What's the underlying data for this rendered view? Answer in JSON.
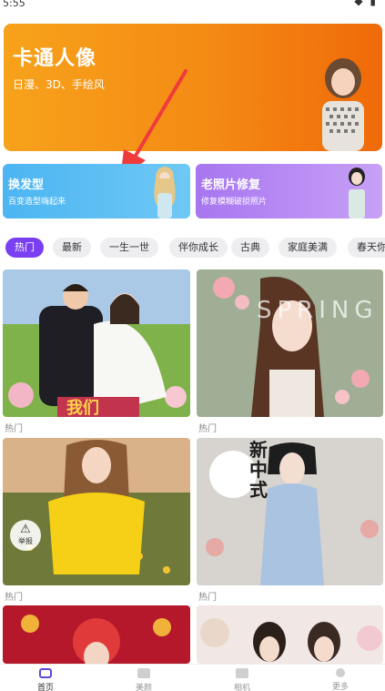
{
  "status": {
    "time": "5:55",
    "icons": "◆ ▮"
  },
  "hero": {
    "title": "卡通人像",
    "subtitle": "日漫、3D、手绘风"
  },
  "cards": [
    {
      "title": "换发型",
      "subtitle": "百变造型嗨起来"
    },
    {
      "title": "老照片修复",
      "subtitle": "修复模糊破损照片"
    }
  ],
  "tabs": [
    "热门",
    "最新",
    "一生一世",
    "伴你成长",
    "古典",
    "家庭美满",
    "春天你"
  ],
  "grid": [
    {
      "label": "热门",
      "overlay": "我们"
    },
    {
      "label": "热门",
      "overlay": "SPRING"
    },
    {
      "label": "热门",
      "overlay": ""
    },
    {
      "label": "热门",
      "overlay": "新中式"
    }
  ],
  "report": {
    "label": "举报",
    "icon": "warning-icon"
  },
  "nav": [
    {
      "label": "首页",
      "icon": "camera-icon",
      "active": true
    },
    {
      "label": "美颜",
      "icon": "folder-icon",
      "active": false
    },
    {
      "label": "相机",
      "icon": "album-icon",
      "active": false
    },
    {
      "label": "更多",
      "icon": "user-icon",
      "active": false
    }
  ],
  "colors": {
    "accent": "#7b3ff2",
    "hero": "#f48a14",
    "card_hair": "#4cb5f2",
    "card_photo": "#a776f0",
    "arrow": "#ef3b3b"
  }
}
